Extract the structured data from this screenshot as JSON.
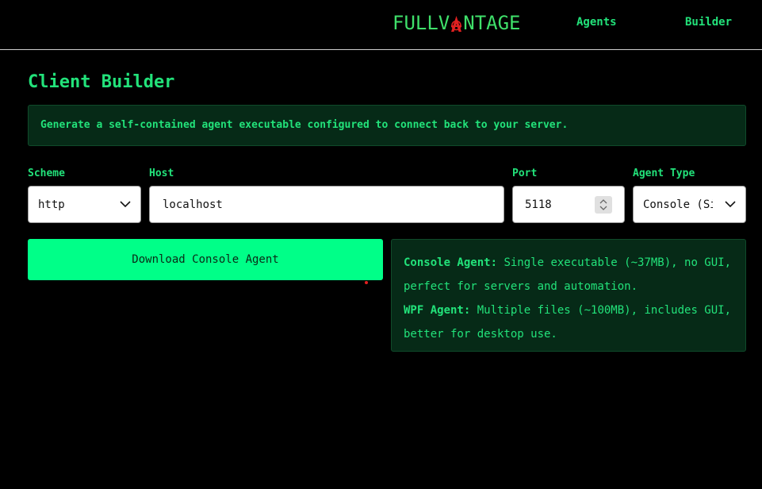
{
  "header": {
    "logo_prefix": "FULLV",
    "logo_suffix": "NTAGE",
    "logo_icon": "anarchy-a-icon",
    "nav": [
      {
        "label": "Agents"
      },
      {
        "label": "Builder"
      }
    ]
  },
  "page": {
    "title": "Client Builder",
    "description": "Generate a self-contained agent executable configured to connect back to your server."
  },
  "form": {
    "scheme": {
      "label": "Scheme",
      "value": "http"
    },
    "host": {
      "label": "Host",
      "value": "localhost"
    },
    "port": {
      "label": "Port",
      "value": "5118"
    },
    "agent_type": {
      "label": "Agent Type",
      "value": "Console (Si"
    }
  },
  "actions": {
    "download_label": "Download Console Agent"
  },
  "agent_info": {
    "console_title": "Console Agent:",
    "console_text": " Single executable (~37MB), no GUI, perfect for servers and automation.",
    "wpf_title": "WPF Agent:",
    "wpf_text": " Multiple files (~100MB), includes GUI, better for desktop use."
  },
  "colors": {
    "accent": "#22e27a",
    "button": "#00ff88",
    "panel_bg": "#062a17",
    "logo_icon": "#e02020"
  }
}
